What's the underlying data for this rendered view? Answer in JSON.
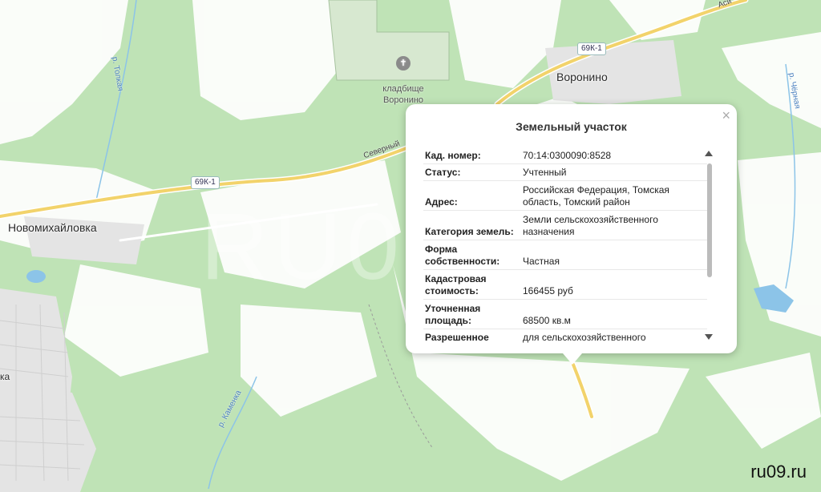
{
  "map": {
    "towns": [
      "Воронино",
      "Новомихайловка",
      "ка"
    ],
    "cemetery": "кладбище\nВоронино",
    "rivers": [
      "р. Толкая",
      "р. Каменка",
      "р. Чёрная"
    ],
    "roads": [
      "Северный",
      "Аси"
    ],
    "road_shields": [
      "69К-1",
      "69К-1"
    ],
    "watermark": "RU09.RU",
    "credit": "ru09.ru",
    "colors": {
      "forest": "#bfe3b6",
      "open_land": "#ffffff",
      "road": "#f2d36b",
      "water": "#8cc4e8"
    }
  },
  "popup": {
    "title": "Земельный участок",
    "close_icon": "×",
    "rows": [
      {
        "k": "Кад. номер:",
        "v": "70:14:0300090:8528"
      },
      {
        "k": "Статус:",
        "v": "Учтенный"
      },
      {
        "k": "Адрес:",
        "v": "Российская Федерация, Томская область, Томский район"
      },
      {
        "k": "Категория земель:",
        "v": "Земли сельскохозяйственного назначения"
      },
      {
        "k": "Форма собственности:",
        "v": "Частная"
      },
      {
        "k": "Кадастровая стоимость:",
        "v": "166455 руб"
      },
      {
        "k": "Уточненная площадь:",
        "v": "68500 кв.м"
      },
      {
        "k": "Разрешенное",
        "v": "для сельскохозяйственного"
      }
    ]
  }
}
